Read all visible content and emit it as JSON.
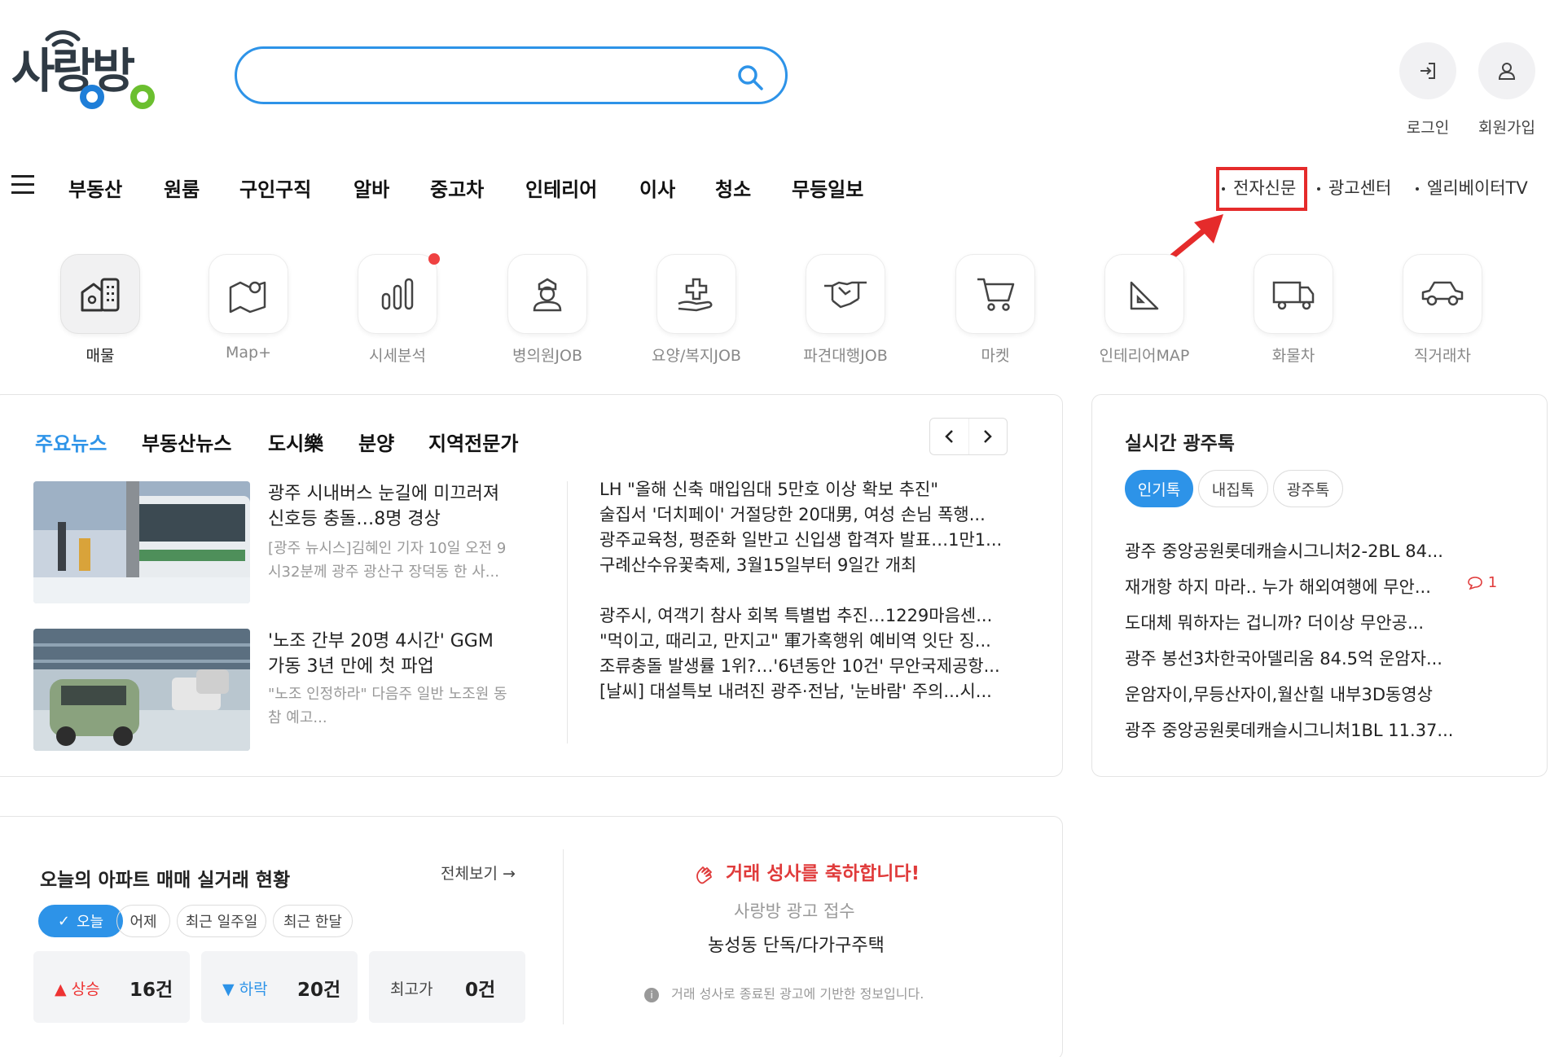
{
  "logo": {
    "text": "사랑방"
  },
  "search": {
    "placeholder": "",
    "value": ""
  },
  "account": {
    "login": "로그인",
    "signup": "회원가입"
  },
  "nav": {
    "items": [
      "부동산",
      "원룸",
      "구인구직",
      "알바",
      "중고차",
      "인테리어",
      "이사",
      "청소",
      "무등일보"
    ],
    "right": [
      "전자신문",
      "광고센터",
      "엘리베이터TV"
    ]
  },
  "categories": [
    {
      "label": "매물",
      "icon": "building-icon"
    },
    {
      "label": "Map+",
      "icon": "map-icon"
    },
    {
      "label": "시세분석",
      "icon": "bar-chart-icon"
    },
    {
      "label": "병의원JOB",
      "icon": "nurse-icon"
    },
    {
      "label": "요양/복지JOB",
      "icon": "care-hand-icon"
    },
    {
      "label": "파견대행JOB",
      "icon": "handshake-icon"
    },
    {
      "label": "마켓",
      "icon": "cart-icon"
    },
    {
      "label": "인테리어MAP",
      "icon": "ruler-icon"
    },
    {
      "label": "화물차",
      "icon": "truck-icon"
    },
    {
      "label": "직거래차",
      "icon": "car-icon"
    }
  ],
  "news": {
    "tabs": [
      "주요뉴스",
      "부동산뉴스",
      "도시樂",
      "분양",
      "지역전문가"
    ],
    "featured": [
      {
        "title": "광주 시내버스 눈길에 미끄러져 신호등 충돌…8명 경상",
        "desc": "[광주 뉴시스]김혜인 기자 10일 오전 9시32분께 광주 광산구 장덕동 한 사..."
      },
      {
        "title": "'노조 간부 20명 4시간' GGM 가동 3년 만에 첫 파업",
        "desc": "\"노조 인정하라\" 다음주 일반 노조원 동참 예고..."
      }
    ],
    "list1": [
      "LH \"올해 신축 매입임대 5만호 이상 확보 추진\"",
      "술집서 '더치페이' 거절당한 20대男, 여성 손님 폭행...",
      "광주교육청, 평준화 일반고 신입생 합격자 발표…1만1...",
      "구례산수유꽃축제, 3월15일부터 9일간 개최"
    ],
    "list2": [
      "광주시, 여객기 참사 회복 특별법 추진…1229마음센...",
      "\"먹이고, 때리고, 만지고\" 軍가혹행위 예비역 잇단 징...",
      "조류충돌 발생률 1위?…'6년동안 10건' 무안국제공항...",
      "[날씨] 대설특보 내려진 광주·전남, '눈바람' 주의...시..."
    ]
  },
  "talk": {
    "title": "실시간 광주톡",
    "tabs": [
      "인기톡",
      "내집톡",
      "광주톡"
    ],
    "items": [
      "광주 중앙공원롯데캐슬시그니처2-2BL 84...",
      "재개항 하지 마라.. 누가 해외여행에 무안...",
      "도대체 뭐하자는 겁니까? 더이상 무안공...",
      "광주 봉선3차한국아델리움 84.5억 운암자...",
      "운암자이,무등산자이,월산힐 내부3D동영상",
      "광주 중앙공원롯데캐슬시그니처1BL 11.37..."
    ],
    "comment_count": "1"
  },
  "deals": {
    "title": "오늘의 아파트 매매 실거래 현황",
    "view_all": "전체보기",
    "chips": [
      "오늘",
      "어제",
      "최근 일주일",
      "최근 한달"
    ],
    "stats": [
      {
        "label": "상승",
        "value": "16건"
      },
      {
        "label": "하락",
        "value": "20건"
      },
      {
        "label": "최고가",
        "value": "0건"
      }
    ],
    "congrats": "거래 성사를 축하합니다!",
    "ad_sub": "사랑방 광고 접수",
    "ad_addr": "농성동 단독/다가구주택",
    "note": "거래 성사로 종료된 광고에 기반한 정보입니다."
  },
  "colors": {
    "accent": "#2d93e8",
    "highlight": "#e52b2b",
    "up": "#ee3333",
    "down": "#2d93e8"
  }
}
